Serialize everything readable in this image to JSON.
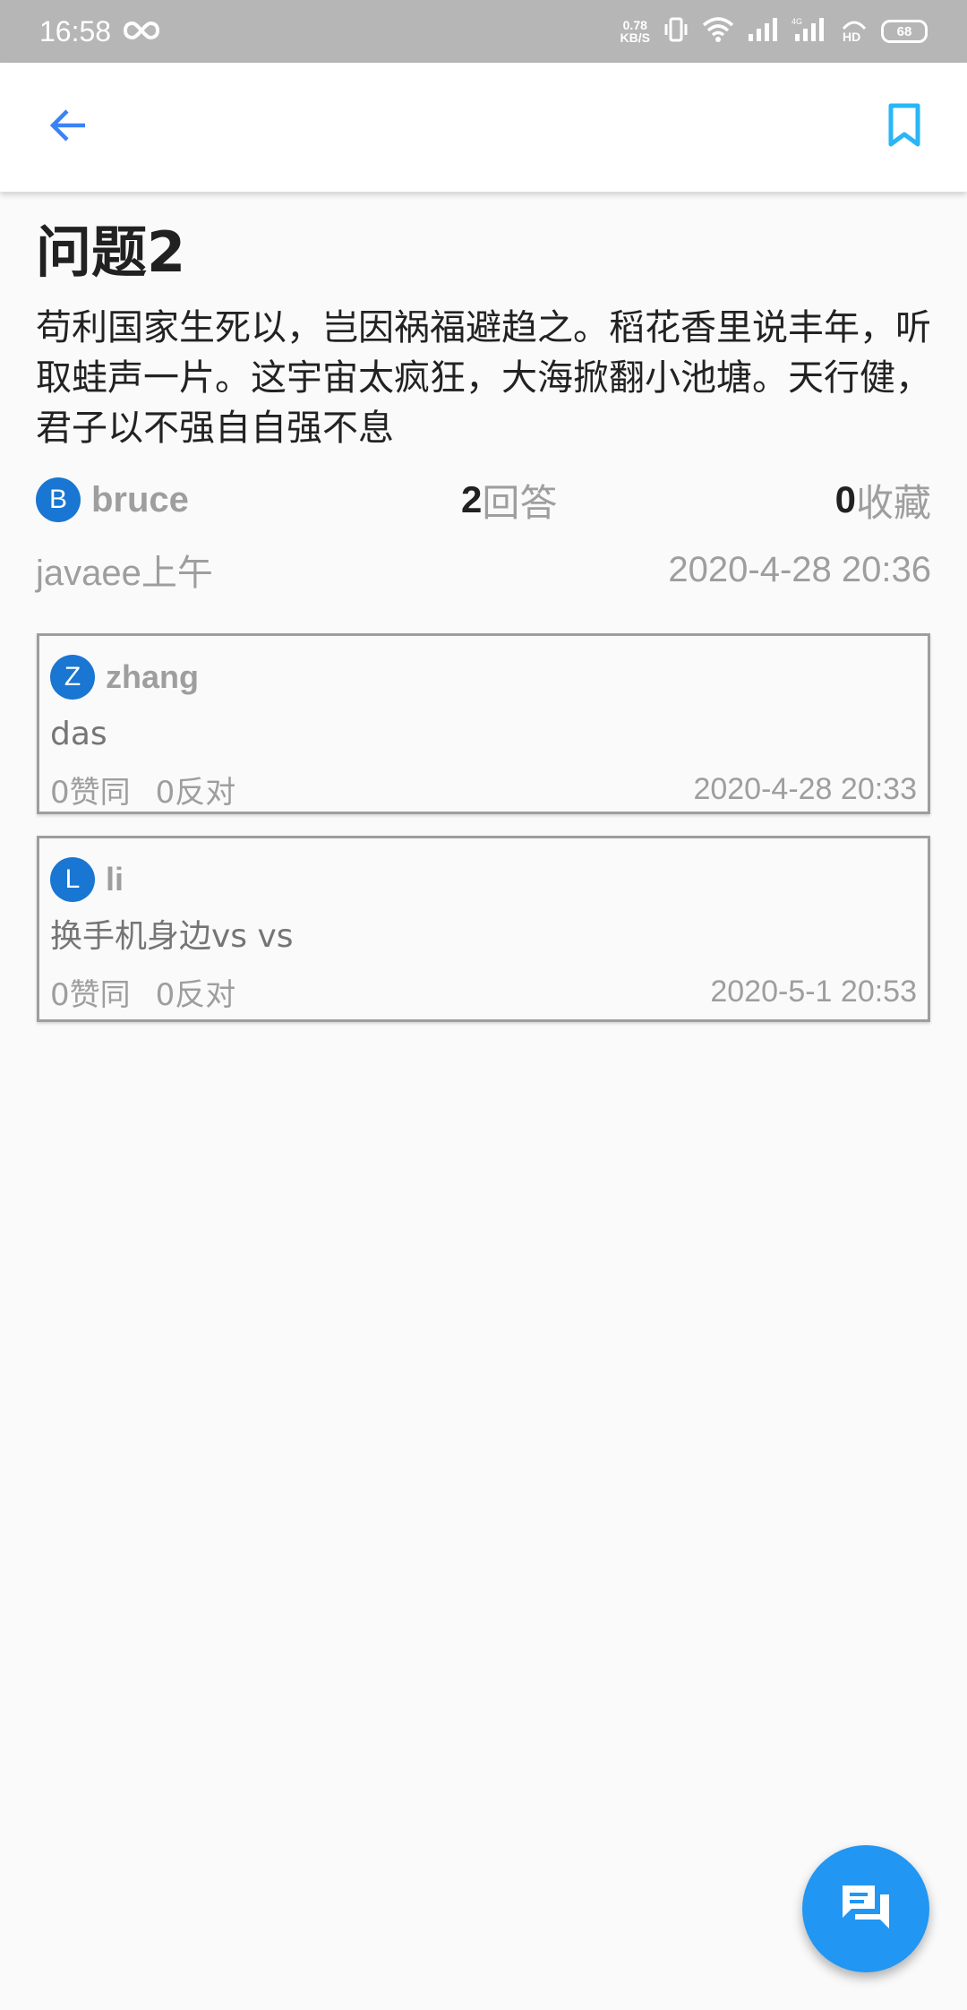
{
  "status_bar": {
    "time": "16:58",
    "net_speed_value": "0.78",
    "net_speed_unit": "KB/S",
    "battery": "68"
  },
  "question": {
    "title": "问题2",
    "content": "苟利国家生死以，岂因祸福避趋之。稻花香里说丰年，听取蛙声一片。这宇宙太疯狂，大海掀翻小池塘。天行健，君子以不强自自强不息",
    "author_initial": "B",
    "author": "bruce",
    "answer_count": "2",
    "answer_label": "回答",
    "favorite_count": "0",
    "favorite_label": "收藏",
    "category": "javaee上午",
    "time": "2020-4-28 20:36"
  },
  "answers": [
    {
      "initial": "Z",
      "user": "zhang",
      "content": "das",
      "agree": "0赞同",
      "oppose": "0反对",
      "time": "2020-4-28 20:33"
    },
    {
      "initial": "L",
      "user": "li",
      "content": "换手机身边vs vs",
      "agree": "0赞同",
      "oppose": "0反对",
      "time": "2020-5-1 20:53"
    }
  ],
  "icons": {
    "back": "arrow-left-icon",
    "bookmark": "bookmark-icon",
    "fab": "forum-icon"
  },
  "colors": {
    "accent": "#2196f3",
    "avatar": "#1976d2",
    "back_arrow": "#3b82f6",
    "bookmark": "#29b6f6"
  }
}
